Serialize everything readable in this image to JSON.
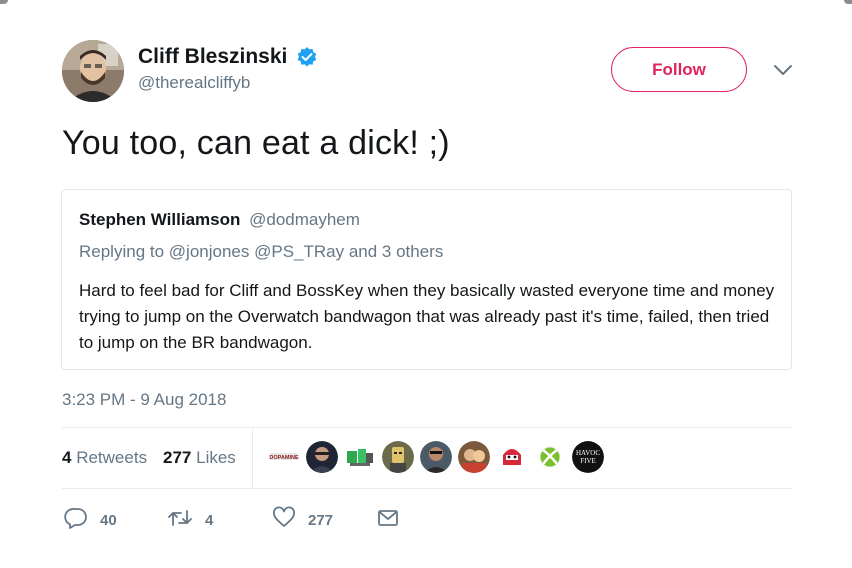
{
  "author": {
    "display_name": "Cliff Bleszinski",
    "handle": "@therealcliffyb",
    "verified": true
  },
  "follow_label": "Follow",
  "tweet_text": "You too, can eat a dick! ;)",
  "quoted": {
    "display_name": "Stephen Williamson",
    "handle": "@dodmayhem",
    "replying_prefix": "Replying to",
    "replying_to": "@jonjones @PS_TRay and 3 others",
    "body": "Hard to feel bad for Cliff and BossKey when they basically wasted everyone time and money trying to jump on the Overwatch bandwagon that was already past it's time, failed, then tried to jump on the BR bandwagon."
  },
  "timestamp": "3:23 PM - 9 Aug 2018",
  "stats": {
    "retweets_count": "4",
    "retweets_label": "Retweets",
    "likes_count": "277",
    "likes_label": "Likes"
  },
  "likers": [
    {
      "name": "liker-1",
      "text": "DOPAMINE"
    },
    {
      "name": "liker-2",
      "text": ""
    },
    {
      "name": "liker-3",
      "text": ""
    },
    {
      "name": "liker-4",
      "text": ""
    },
    {
      "name": "liker-5",
      "text": ""
    },
    {
      "name": "liker-6",
      "text": ""
    },
    {
      "name": "liker-7",
      "text": ""
    },
    {
      "name": "liker-8",
      "text": ""
    },
    {
      "name": "liker-9",
      "text": "HAVOC FIVE"
    }
  ],
  "actions": {
    "reply_count": "40",
    "retweet_count": "4",
    "like_count": "277"
  },
  "colors": {
    "accent": "#e0245e",
    "verified": "#1da1f2",
    "muted": "#657786"
  },
  "icons": [
    "verified-icon",
    "chevron-down-icon",
    "reply-icon",
    "retweet-icon",
    "heart-icon",
    "direct-message-icon"
  ]
}
